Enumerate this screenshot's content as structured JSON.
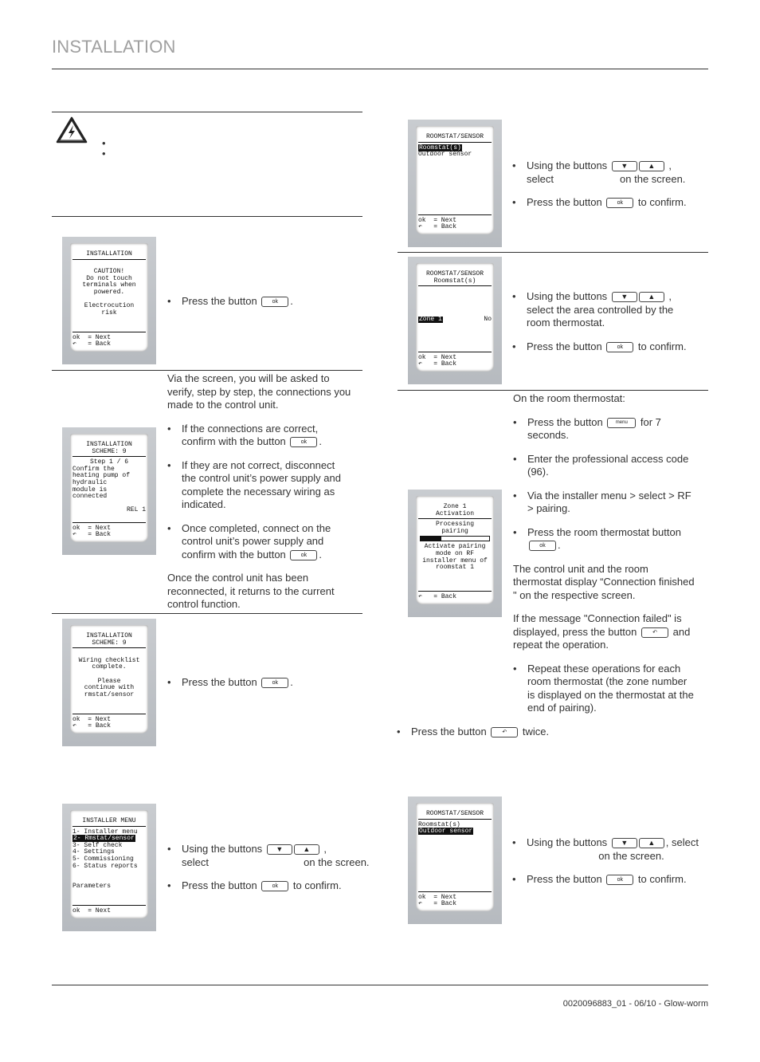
{
  "header": {
    "title": "INSTALLATION"
  },
  "footer": {
    "doc": "0020096883_01 - 06/10 - Glow-worm"
  },
  "colors": {
    "header": "#a0a0a0",
    "text": "#333333"
  },
  "icons": {
    "warning": "electric-hazard-triangle",
    "ok": "ok",
    "down": "arrow-down",
    "up": "arrow-up",
    "back": "back-arrow",
    "menu": "menu"
  },
  "screens": [
    {
      "id": "installation-caution",
      "title": [
        "INSTALLATION"
      ],
      "body": [
        {
          "t": ""
        },
        {
          "t": "CAUTION!",
          "a": "c"
        },
        {
          "t": "Do not touch",
          "a": "c"
        },
        {
          "t": "terminals when",
          "a": "c"
        },
        {
          "t": "powered.",
          "a": "c"
        },
        {
          "t": ""
        },
        {
          "t": "Electrocution",
          "a": "c"
        },
        {
          "t": "risk",
          "a": "c"
        }
      ],
      "footer": [
        "ok  = Next",
        "↶   = Back"
      ]
    },
    {
      "id": "installation-step",
      "title": [
        "INSTALLATION",
        "SCHEME: 9"
      ],
      "body": [
        {
          "t": "Step 1 / 6",
          "a": "c"
        },
        {
          "t": "Confirm the"
        },
        {
          "t": "heating pump of"
        },
        {
          "t": "hydraulic"
        },
        {
          "t": "module is"
        },
        {
          "t": "connected"
        },
        {
          "t": ""
        },
        {
          "t": "REL 1",
          "a": "r"
        }
      ],
      "footer": [
        "ok  = Next",
        "↶   = Back"
      ]
    },
    {
      "id": "installation-complete",
      "title": [
        "INSTALLATION",
        "SCHEME: 9"
      ],
      "body": [
        {
          "t": ""
        },
        {
          "t": "Wiring checklist",
          "a": "c"
        },
        {
          "t": "complete.",
          "a": "c"
        },
        {
          "t": ""
        },
        {
          "t": "Please",
          "a": "c"
        },
        {
          "t": "continue with",
          "a": "c"
        },
        {
          "t": "rmstat/sensor",
          "a": "c"
        }
      ],
      "footer": [
        "ok  = Next",
        "↶   = Back"
      ]
    },
    {
      "id": "installer-menu",
      "title": [
        "INSTALLER MENU"
      ],
      "body": [
        {
          "t": "1- Installer menu"
        },
        {
          "t": "2- Rmstat/sensor",
          "inv": true
        },
        {
          "t": "3- Self check"
        },
        {
          "t": "4- Settings"
        },
        {
          "t": "5- Commissioning"
        },
        {
          "t": "6- Status reports"
        },
        {
          "t": ""
        },
        {
          "t": ""
        },
        {
          "t": "Parameters"
        }
      ],
      "footer": [
        "ok  = Next"
      ]
    },
    {
      "id": "roomstat-select",
      "title": [
        "ROOMSTAT/SENSOR"
      ],
      "body": [
        {
          "t": "Roomstat(s)",
          "inv": true
        },
        {
          "t": "Outdoor sensor"
        }
      ],
      "footer": [
        "ok  = Next",
        "↶   = Back"
      ]
    },
    {
      "id": "roomstat-zone",
      "title": [
        "ROOMSTAT/SENSOR",
        "Roomstat(s)"
      ],
      "body": [
        {
          "t": ""
        },
        {
          "t": ""
        },
        {
          "t": ""
        },
        {
          "t": ""
        },
        {
          "t": "Zone 1",
          "inv": true,
          "right": "No"
        }
      ],
      "footer": [
        "ok  = Next",
        "↶   = Back"
      ]
    },
    {
      "id": "zone-activation",
      "title": [
        "Zone 1",
        "Activation"
      ],
      "body": [
        {
          "t": "Processing",
          "a": "c"
        },
        {
          "t": "pairing",
          "a": "c"
        },
        {
          "progress": 0.3
        },
        {
          "t": "Activate pairing",
          "a": "c"
        },
        {
          "t": "mode on RF",
          "a": "c"
        },
        {
          "t": "installer menu of",
          "a": "c"
        },
        {
          "t": "roomstat 1",
          "a": "c"
        }
      ],
      "footer": [
        "↶   = Back"
      ]
    },
    {
      "id": "outdoor-sensor-select",
      "title": [
        "ROOMSTAT/SENSOR"
      ],
      "body": [
        {
          "t": "Roomstat(s)"
        },
        {
          "t": "Outdoor sensor",
          "inv": true
        }
      ],
      "footer": [
        "ok  = Next",
        "↶   = Back"
      ]
    }
  ],
  "blocks": [
    {
      "id": "warning-bullets",
      "items": [
        {
          "k": "b",
          "lines": [
            [
              ""
            ]
          ]
        },
        {
          "k": "b",
          "lines": [
            [
              ""
            ]
          ]
        }
      ]
    },
    {
      "id": "caution-step",
      "items": [
        {
          "k": "b",
          "lines": [
            [
              "Press the button ",
              {
                "btn": "ok"
              },
              "."
            ]
          ]
        }
      ]
    },
    {
      "id": "wiring-step",
      "items": [
        {
          "k": "p",
          "lines": [
            [
              "Via the screen, you will be asked to"
            ],
            [
              "verify, step by step, the connections you"
            ],
            [
              "made to the control unit."
            ]
          ]
        },
        {
          "k": "b",
          "lines": [
            [
              "If the connections are correct,"
            ],
            [
              "confirm with the button ",
              {
                "btn": "ok"
              },
              "."
            ]
          ]
        },
        {
          "k": "b",
          "lines": [
            [
              "If they are not correct, disconnect"
            ],
            [
              "the control unit’s power supply and"
            ],
            [
              "complete the necessary wiring as"
            ],
            [
              "indicated."
            ]
          ]
        },
        {
          "k": "b",
          "lines": [
            [
              "Once completed, connect on the"
            ],
            [
              "control unit’s power supply and"
            ],
            [
              "confirm with the button ",
              {
                "btn": "ok"
              },
              "."
            ]
          ]
        },
        {
          "k": "p",
          "lines": [
            [
              "Once the control unit has been"
            ],
            [
              "reconnected, it returns to the current"
            ],
            [
              "control function."
            ]
          ]
        }
      ]
    },
    {
      "id": "complete-step",
      "items": [
        {
          "k": "b",
          "lines": [
            [
              "Press the button ",
              {
                "btn": "ok"
              },
              "."
            ]
          ]
        }
      ]
    },
    {
      "id": "menu-step",
      "items": [
        {
          "k": "b",
          "lines": [
            [
              "Using the buttons ",
              {
                "pair": true
              },
              " ,"
            ],
            [
              "select                                 on the screen."
            ]
          ]
        },
        {
          "k": "b",
          "lines": [
            [
              "Press the button ",
              {
                "btn": "ok"
              },
              " to confirm."
            ]
          ]
        }
      ]
    },
    {
      "id": "roomstat-step",
      "items": [
        {
          "k": "b",
          "lines": [
            [
              "Using the buttons ",
              {
                "pair": true
              },
              " ,"
            ],
            [
              "select                       on the screen."
            ]
          ]
        },
        {
          "k": "b",
          "lines": [
            [
              "Press the button ",
              {
                "btn": "ok"
              },
              " to confirm."
            ]
          ]
        }
      ]
    },
    {
      "id": "zone-step",
      "items": [
        {
          "k": "b",
          "lines": [
            [
              "Using the buttons ",
              {
                "pair": true
              },
              " ,"
            ],
            [
              "select the area controlled by the"
            ],
            [
              "room thermostat."
            ]
          ]
        },
        {
          "k": "b",
          "lines": [
            [
              "Press the button ",
              {
                "btn": "ok"
              },
              " to confirm."
            ]
          ]
        }
      ]
    },
    {
      "id": "pairing-step",
      "items": [
        {
          "k": "p",
          "lines": [
            [
              "On the room thermostat:"
            ]
          ]
        },
        {
          "k": "b",
          "lines": [
            [
              "Press the button ",
              {
                "btn": "menu"
              },
              " for 7"
            ],
            [
              "seconds."
            ]
          ]
        },
        {
          "k": "b",
          "lines": [
            [
              "Enter the professional access code"
            ],
            [
              "(96)."
            ]
          ]
        },
        {
          "k": "b",
          "lines": [
            [
              "Via the installer menu > select > RF"
            ],
            [
              "> pairing."
            ]
          ]
        },
        {
          "k": "b",
          "lines": [
            [
              "Press the room thermostat button"
            ],
            [
              {
                "btn": "ok"
              },
              "."
            ]
          ]
        },
        {
          "k": "p",
          "lines": [
            [
              "The control unit and the room"
            ],
            [
              "thermostat display “Connection finished"
            ],
            [
              "\" on the respective screen."
            ]
          ]
        },
        {
          "k": "p",
          "lines": [
            [
              "If the message \"Connection failed\" is"
            ],
            [
              "displayed, press the button ",
              {
                "btn": "back"
              },
              " and"
            ],
            [
              "repeat the operation."
            ]
          ]
        },
        {
          "k": "b",
          "lines": [
            [
              "Repeat these operations for each"
            ],
            [
              "room thermostat (the zone number"
            ],
            [
              "is displayed on the thermostat at the"
            ],
            [
              "end of pairing)."
            ]
          ]
        }
      ]
    },
    {
      "id": "twice-step",
      "items": [
        {
          "k": "b",
          "lines": [
            [
              "Press the button ",
              {
                "btn": "back"
              },
              " twice."
            ]
          ]
        }
      ]
    },
    {
      "id": "outdoor-step",
      "items": [
        {
          "k": "b",
          "lines": [
            [
              "Using the buttons ",
              {
                "pair": true
              },
              ", select"
            ],
            [
              "                         on the screen."
            ]
          ]
        },
        {
          "k": "b",
          "lines": [
            [
              "Press the button ",
              {
                "btn": "ok"
              },
              " to confirm."
            ]
          ]
        }
      ]
    }
  ]
}
